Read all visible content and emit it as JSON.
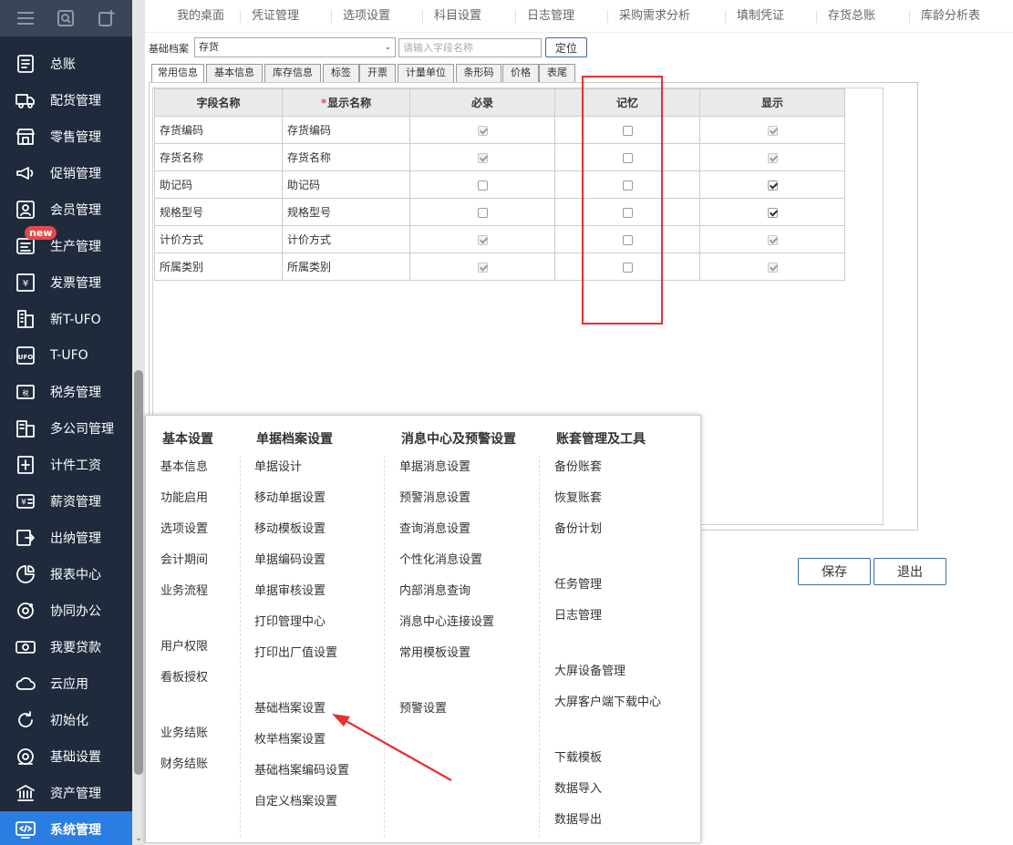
{
  "sidebar": {
    "items": [
      {
        "label": "总账",
        "icon": "ledger-icon"
      },
      {
        "label": "配货管理",
        "icon": "truck-icon"
      },
      {
        "label": "零售管理",
        "icon": "store-icon"
      },
      {
        "label": "促销管理",
        "icon": "megaphone-icon"
      },
      {
        "label": "会员管理",
        "icon": "member-icon"
      },
      {
        "label": "生产管理",
        "icon": "production-icon"
      },
      {
        "label": "发票管理",
        "icon": "invoice-icon"
      },
      {
        "label": "新T-UFO",
        "icon": "building-icon"
      },
      {
        "label": "T-UFO",
        "icon": "ufo-icon"
      },
      {
        "label": "税务管理",
        "icon": "tax-icon"
      },
      {
        "label": "多公司管理",
        "icon": "company-icon"
      },
      {
        "label": "计件工资",
        "icon": "piece-wage-icon"
      },
      {
        "label": "薪资管理",
        "icon": "salary-icon"
      },
      {
        "label": "出纳管理",
        "icon": "cashier-icon"
      },
      {
        "label": "报表中心",
        "icon": "pie-chart-icon"
      },
      {
        "label": "协同办公",
        "icon": "collaboration-icon"
      },
      {
        "label": "我要贷款",
        "icon": "loan-icon"
      },
      {
        "label": "云应用",
        "icon": "cloud-icon"
      },
      {
        "label": "初始化",
        "icon": "refresh-icon"
      },
      {
        "label": "基础设置",
        "icon": "settings-icon"
      },
      {
        "label": "资产管理",
        "icon": "bank-icon"
      },
      {
        "label": "系统管理",
        "icon": "code-icon"
      }
    ],
    "badge": "new"
  },
  "topbar": {
    "tabs": [
      "我的桌面",
      "凭证管理",
      "选项设置",
      "科目设置",
      "日志管理",
      "采购需求分析",
      "填制凭证",
      "存货总账",
      "库龄分析表"
    ]
  },
  "form": {
    "archive_label": "基础档案",
    "archive_value": "存货",
    "search_placeholder": "请输入字段名称",
    "locate_label": "定位"
  },
  "subtabs": [
    "常用信息",
    "基本信息",
    "库存信息",
    "标签",
    "开票",
    "计量单位",
    "条形码",
    "价格",
    "表尾"
  ],
  "table": {
    "headers": [
      "字段名称",
      "显示名称",
      "必录",
      "记忆",
      "显示"
    ],
    "required_mark": "*",
    "rows": [
      {
        "field": "存货编码",
        "display": "存货编码",
        "required": true,
        "required_locked": true,
        "memory": false,
        "show": true,
        "show_locked": true
      },
      {
        "field": "存货名称",
        "display": "存货名称",
        "required": true,
        "required_locked": true,
        "memory": false,
        "show": true,
        "show_locked": true
      },
      {
        "field": "助记码",
        "display": "助记码",
        "required": false,
        "required_locked": false,
        "memory": false,
        "show": true,
        "show_locked": false
      },
      {
        "field": "规格型号",
        "display": "规格型号",
        "required": false,
        "required_locked": false,
        "memory": false,
        "show": true,
        "show_locked": false
      },
      {
        "field": "计价方式",
        "display": "计价方式",
        "required": true,
        "required_locked": true,
        "memory": false,
        "show": true,
        "show_locked": true
      },
      {
        "field": "所属类别",
        "display": "所属类别",
        "required": true,
        "required_locked": true,
        "memory": false,
        "show": true,
        "show_locked": true
      }
    ]
  },
  "buttons": {
    "save": "保存",
    "exit": "退出"
  },
  "menu": {
    "columns": [
      {
        "title": "基本设置",
        "items": [
          "基本信息",
          "功能启用",
          "选项设置",
          "会计期间",
          "业务流程",
          "用户权限",
          "看板授权",
          "业务结账",
          "财务结账"
        ]
      },
      {
        "title": "单据档案设置",
        "items": [
          "单据设计",
          "移动单据设置",
          "移动模板设置",
          "单据编码设置",
          "单据审核设置",
          "打印管理中心",
          "打印出厂值设置",
          "基础档案设置",
          "枚举档案设置",
          "基础档案编码设置",
          "自定义档案设置"
        ]
      },
      {
        "title": "消息中心及预警设置",
        "items": [
          "单据消息设置",
          "预警消息设置",
          "查询消息设置",
          "个性化消息设置",
          "内部消息查询",
          "消息中心连接设置",
          "常用模板设置",
          "预警设置"
        ]
      },
      {
        "title": "账套管理及工具",
        "items": [
          "备份账套",
          "恢复账套",
          "备份计划",
          "任务管理",
          "日志管理",
          "大屏设备管理",
          "大屏客户端下载中心",
          "下载模板",
          "数据导入",
          "数据导出"
        ]
      }
    ]
  },
  "colors": {
    "sidebar_bg": "#1f2a3c",
    "active": "#2a7de1",
    "highlight": "#e83030"
  }
}
